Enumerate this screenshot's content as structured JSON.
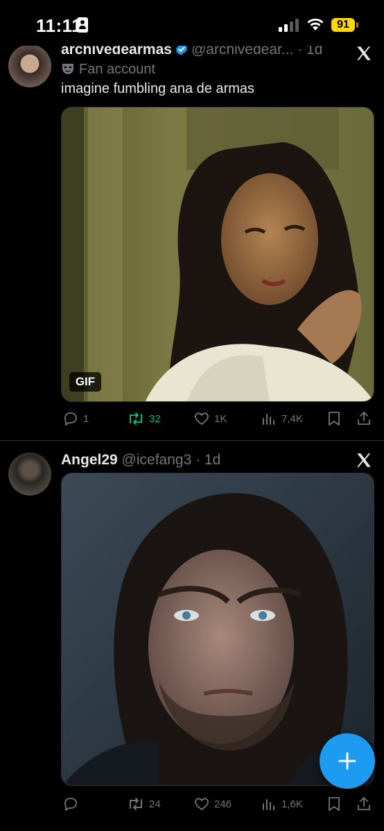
{
  "status_bar": {
    "time": "11:11",
    "battery": "91",
    "icons": [
      "id-card-icon",
      "cellular-signal-icon",
      "wifi-icon",
      "battery-icon"
    ]
  },
  "tweets": [
    {
      "display_name": "archivedearmas",
      "handle": "@archivedear...",
      "time": "· 1d",
      "verified": true,
      "label": "Fan account",
      "text": "imagine fumbling ana de armas",
      "media_badge": "GIF",
      "actions": {
        "replies": "1",
        "reposts": "32",
        "likes": "1K",
        "views": "7,4K"
      }
    },
    {
      "display_name": "Angel29",
      "handle": "@icefang3",
      "time": "· 1d",
      "verified": false,
      "actions": {
        "replies": "",
        "reposts": "24",
        "likes": "246",
        "views": "1,6K"
      }
    }
  ],
  "colors": {
    "background": "#000000",
    "text": "#e7e9ea",
    "secondary": "#71767b",
    "accent": "#1d9bf0",
    "repost_active": "#00ba7c",
    "battery": "#ffd60a"
  }
}
